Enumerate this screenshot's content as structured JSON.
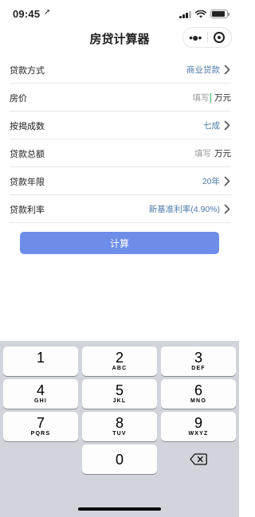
{
  "status_bar": {
    "time": "09:45",
    "location_glyph": "➚",
    "battery_level": 0.9
  },
  "nav": {
    "title": "房贷计算器",
    "more_glyph": "•●•"
  },
  "form": {
    "rows": [
      {
        "label": "贷款方式",
        "value": "商业贷款",
        "has_arrow": true
      },
      {
        "label": "房价",
        "placeholder": "填写",
        "unit": "万元"
      },
      {
        "label": "按揭成数",
        "value": "七成",
        "has_arrow": true
      },
      {
        "label": "贷款总额",
        "placeholder": "填写",
        "unit": "万元"
      },
      {
        "label": "贷款年限",
        "value": "20年",
        "has_arrow": true
      },
      {
        "label": "贷款利率",
        "value": "新基准利率(4.90%)",
        "has_arrow": true
      }
    ]
  },
  "calculate_button": {
    "label": "计算"
  },
  "keyboard": {
    "keys": [
      {
        "num": "1",
        "letters": ""
      },
      {
        "num": "2",
        "letters": "ABC"
      },
      {
        "num": "3",
        "letters": "DEF"
      },
      {
        "num": "4",
        "letters": "GHI"
      },
      {
        "num": "5",
        "letters": "JKL"
      },
      {
        "num": "6",
        "letters": "MNO"
      },
      {
        "num": "7",
        "letters": "PQRS"
      },
      {
        "num": "8",
        "letters": "TUV"
      },
      {
        "num": "9",
        "letters": "WXYZ"
      },
      {
        "num": "0",
        "letters": ""
      }
    ]
  },
  "colors": {
    "accent": "#6d8ee8",
    "value_text": "#4a78a8",
    "cursor": "#2bbf58"
  }
}
